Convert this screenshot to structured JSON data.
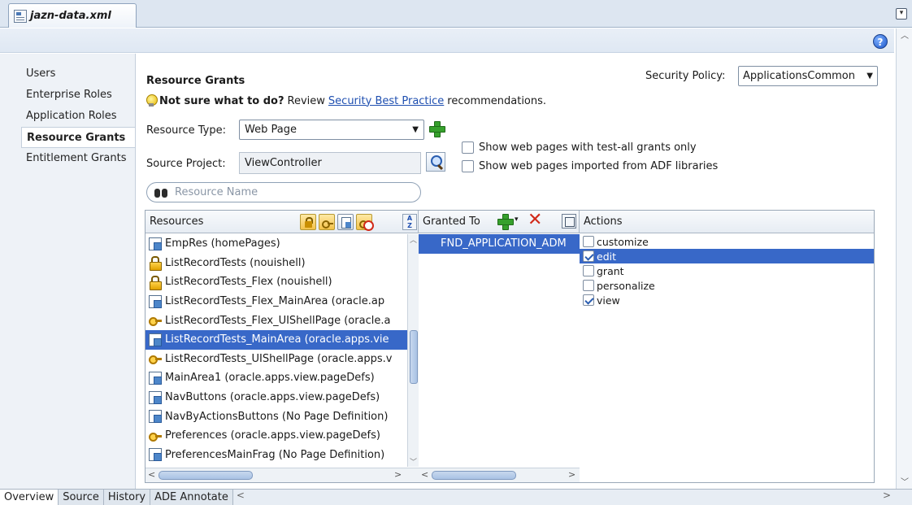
{
  "editor": {
    "tab_label": "jazn-data.xml"
  },
  "nav": {
    "items": [
      {
        "label": "Users"
      },
      {
        "label": "Enterprise Roles"
      },
      {
        "label": "Application Roles"
      },
      {
        "label": "Resource Grants",
        "active": true
      },
      {
        "label": "Entitlement Grants"
      }
    ]
  },
  "header": {
    "title": "Resource Grants",
    "security_policy_label": "Security Policy:",
    "security_policy_value": "ApplicationsCommon",
    "hint_bold": "Not sure what to do?",
    "hint_pre": "Review",
    "hint_link": "Security Best Practice",
    "hint_post": "recommendations."
  },
  "form": {
    "resource_type_label": "Resource Type:",
    "resource_type_value": "Web Page",
    "source_project_label": "Source Project:",
    "source_project_value": "ViewController",
    "checkbox_test_all": "Show web pages with test-all grants only",
    "checkbox_adf": "Show web pages imported from ADF libraries",
    "search_placeholder": "Resource Name"
  },
  "resources": {
    "header": "Resources",
    "items": [
      {
        "icon": "page-icon",
        "label": "EmpRes (homePages)"
      },
      {
        "icon": "lock-icon",
        "label": "ListRecordTests (nouishell)"
      },
      {
        "icon": "lock-icon",
        "label": "ListRecordTests_Flex (nouishell)"
      },
      {
        "icon": "page-icon",
        "label": "ListRecordTests_Flex_MainArea (oracle.ap"
      },
      {
        "icon": "key-icon",
        "label": "ListRecordTests_Flex_UIShellPage (oracle.a"
      },
      {
        "icon": "page-icon",
        "label": "ListRecordTests_MainArea (oracle.apps.vie",
        "selected": true
      },
      {
        "icon": "key-icon",
        "label": "ListRecordTests_UIShellPage (oracle.apps.v"
      },
      {
        "icon": "page-icon",
        "label": "MainArea1 (oracle.apps.view.pageDefs)"
      },
      {
        "icon": "page-icon",
        "label": "NavButtons (oracle.apps.view.pageDefs)"
      },
      {
        "icon": "page-icon",
        "label": "NavByActionsButtons (No Page Definition)"
      },
      {
        "icon": "key-icon",
        "label": "Preferences (oracle.apps.view.pageDefs)"
      },
      {
        "icon": "page-icon",
        "label": "PreferencesMainFrag (No Page Definition)"
      }
    ]
  },
  "granted_to": {
    "header": "Granted To",
    "items": [
      {
        "label": "FND_APPLICATION_ADM",
        "selected": true
      }
    ]
  },
  "actions": {
    "header": "Actions",
    "items": [
      {
        "label": "customize",
        "checked": false
      },
      {
        "label": "edit",
        "checked": true,
        "selected": true
      },
      {
        "label": "grant",
        "checked": false
      },
      {
        "label": "personalize",
        "checked": false
      },
      {
        "label": "view",
        "checked": true
      }
    ]
  },
  "bottom_tabs": [
    {
      "label": "Overview",
      "active": true
    },
    {
      "label": "Source"
    },
    {
      "label": "History"
    },
    {
      "label": "ADE Annotate"
    }
  ]
}
